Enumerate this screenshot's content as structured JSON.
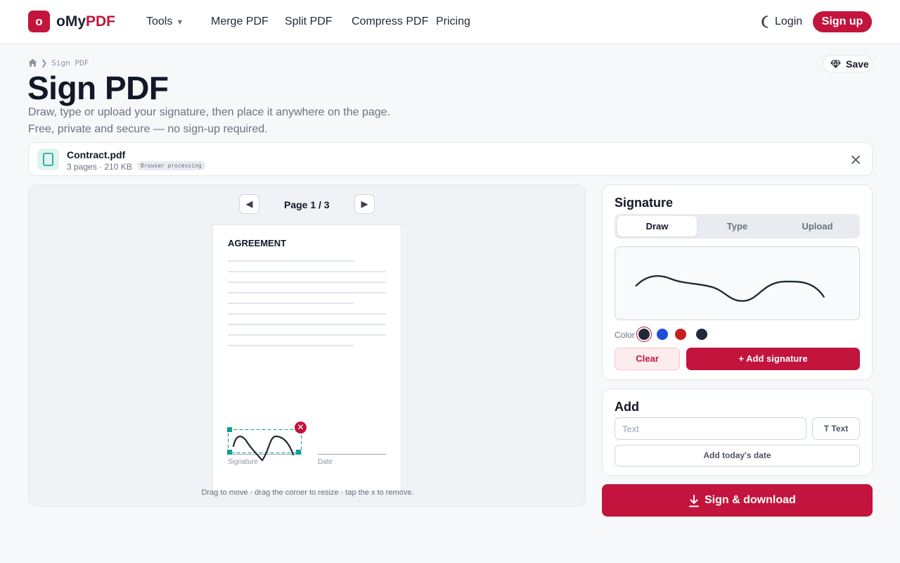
{
  "brand": {
    "logo_letter": "o",
    "name_prefix": "oMy",
    "name_accent": "PDF",
    "accent_color": "#c2143c"
  },
  "nav": {
    "tools_label": "Tools",
    "merge_label": "Merge PDF",
    "split_label": "Split PDF",
    "compress_label": "Compress PDF",
    "pricing_label": "Pricing",
    "login_label": "Login",
    "signup_label": "Sign up",
    "theme_icon": "moon-icon"
  },
  "breadcrumb": {
    "home_icon": "home-icon",
    "current": "Sign PDF"
  },
  "page": {
    "title": "Sign PDF",
    "subtitle_line1": "Draw, type or upload your signature, then place it anywhere on the page.",
    "subtitle_line2": "Free, private and secure — no sign-up required.",
    "save_label": "Save"
  },
  "file": {
    "name": "Contract.pdf",
    "meta": "3 pages · 210 KB",
    "badge": "Browser processing",
    "icon": "document-icon"
  },
  "preview": {
    "page_label": "Page 1 / 3",
    "doc_heading": "AGREEMENT",
    "signature_label": "Signature",
    "date_label": "Date",
    "hint": "Drag to move · drag the corner to resize · tap the x to remove.",
    "remove_glyph": "✕",
    "prev_glyph": "◀",
    "next_glyph": "▶"
  },
  "signature_panel": {
    "title": "Signature",
    "tabs": [
      "Draw",
      "Type",
      "Upload"
    ],
    "active_tab": "Draw",
    "color_label": "Color",
    "colors": [
      "#1f2937",
      "#1d4ed8",
      "#c81e1e",
      "#1f2937"
    ],
    "selected_color": "#1f2937",
    "clear_label": "Clear",
    "add_label": "+ Add signature"
  },
  "add_panel": {
    "title": "Add",
    "text_placeholder": "Text",
    "text_value": "",
    "text_button": "T Text",
    "date_button": "Add today's date"
  },
  "download": {
    "label": "Sign & download",
    "icon": "download-icon"
  }
}
